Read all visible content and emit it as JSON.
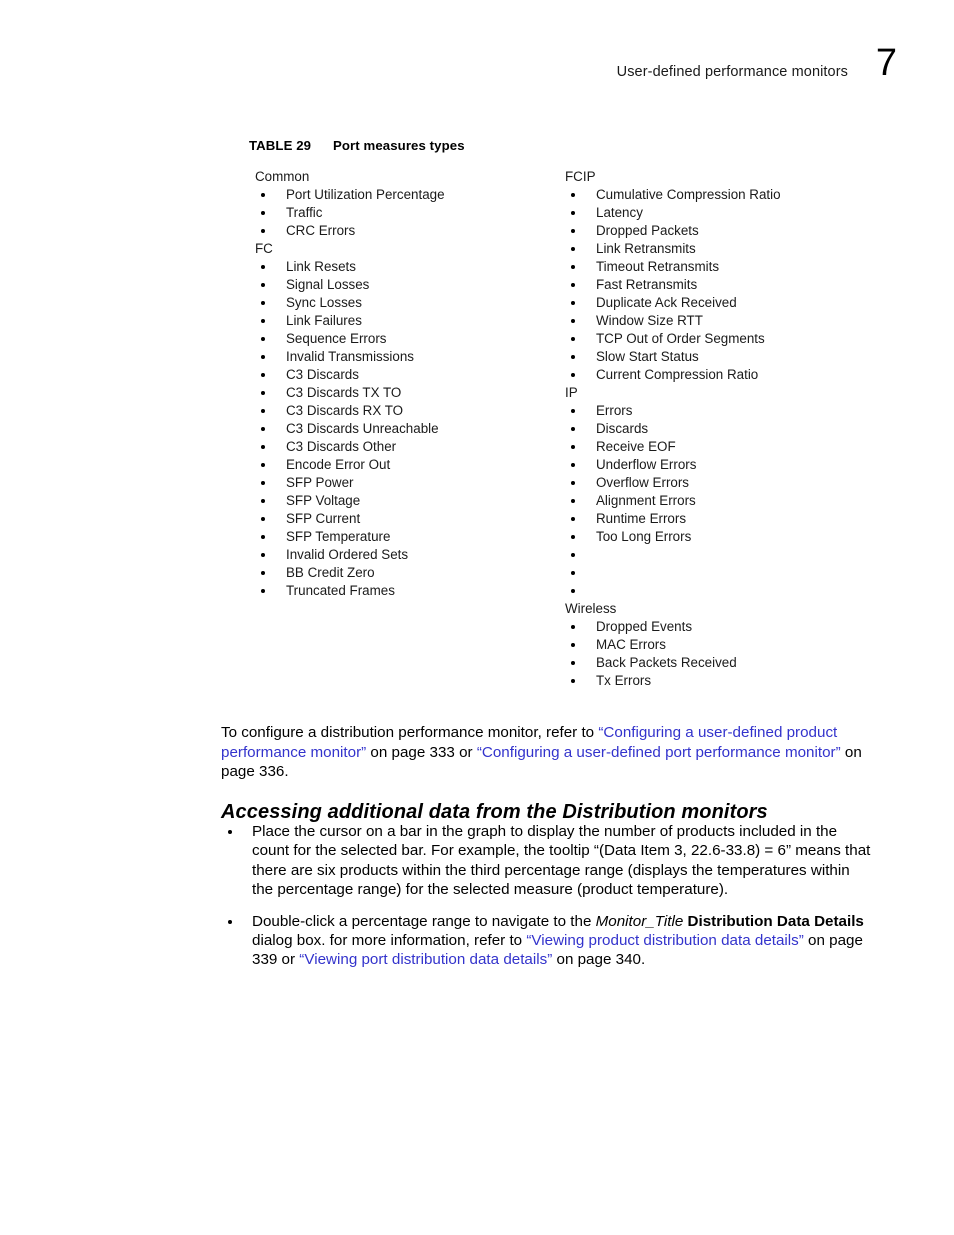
{
  "header": {
    "title": "User-defined performance monitors",
    "chapter_number": "7"
  },
  "table": {
    "caption_number": "TABLE 29",
    "caption_title": "Port measures types",
    "columns": [
      {
        "groups": [
          {
            "label": "Common",
            "items": [
              "Port Utilization Percentage",
              "Traffic",
              "CRC Errors"
            ]
          },
          {
            "label": "FC",
            "items": [
              "Link Resets",
              "Signal Losses",
              "Sync Losses",
              "Link Failures",
              "Sequence Errors",
              "Invalid Transmissions",
              "C3 Discards",
              "C3 Discards TX TO",
              "C3 Discards RX TO",
              "C3 Discards Unreachable",
              "C3 Discards Other",
              "Encode Error Out",
              "SFP Power",
              "SFP Voltage",
              "SFP Current",
              "SFP Temperature",
              "Invalid Ordered Sets",
              "BB Credit Zero",
              "Truncated Frames"
            ]
          }
        ]
      },
      {
        "groups": [
          {
            "label": "FCIP",
            "items": [
              "Cumulative Compression Ratio",
              "Latency",
              "Dropped Packets",
              "Link Retransmits",
              "Timeout Retransmits",
              "Fast Retransmits",
              "Duplicate Ack Received",
              "Window Size RTT",
              "TCP Out of Order Segments",
              "Slow Start Status",
              "Current Compression Ratio"
            ]
          },
          {
            "label": "IP",
            "items": [
              "Errors",
              "Discards",
              "Receive EOF",
              "Underflow Errors",
              "Overflow Errors",
              "Alignment Errors",
              "Runtime Errors",
              "Too Long Errors",
              "",
              "",
              ""
            ]
          },
          {
            "label": "Wireless",
            "items": [
              "Dropped Events",
              "MAC Errors",
              "Back Packets Received",
              "Tx Errors"
            ]
          }
        ]
      }
    ]
  },
  "paragraphs": {
    "refer_intro": "To configure a distribution performance monitor, refer to ",
    "refer_link1": "“Configuring a user-defined product performance monitor”",
    "refer_mid": " on page 333 or ",
    "refer_link2": "“Configuring a user-defined port performance monitor”",
    "refer_end": " on page 336."
  },
  "section": {
    "heading": "Accessing additional data from the Distribution monitors"
  },
  "bullets": {
    "item1": "Place the cursor on a bar in the graph to display the number of products included in the count for the selected bar. For example, the tooltip “(Data Item 3, 22.6-33.8) = 6” means that there are six products within the third percentage range (displays the temperatures within the percentage range) for the selected measure (product temperature).",
    "item2_a": "Double-click a percentage range to navigate to the ",
    "item2_italic": "Monitor_Title",
    "item2_bold": " Distribution Data Details",
    "item2_b": " dialog box. for more information, refer to ",
    "item2_link1": "“Viewing product distribution data details”",
    "item2_c": " on page 339 or ",
    "item2_link2": "“Viewing port distribution data details”",
    "item2_d": " on page 340."
  },
  "colors": {
    "link": "#3333cc",
    "text": "#000000",
    "page_background": "#ffffff"
  }
}
